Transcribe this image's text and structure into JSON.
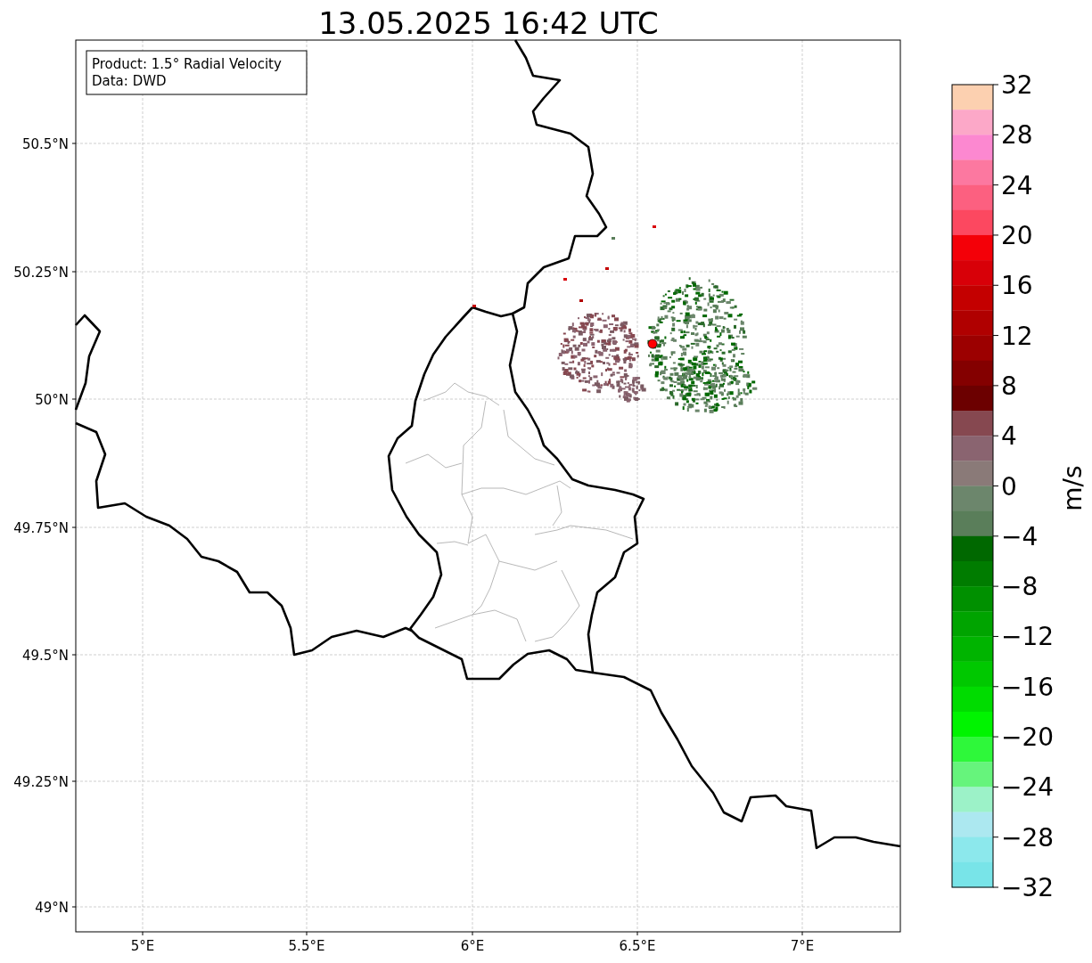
{
  "title": "13.05.2025 16:42 UTC",
  "info_box": [
    "Product: 1.5° Radial Velocity",
    "Data: DWD"
  ],
  "lat_ticks": [
    "50.5°N",
    "50.25°N",
    "50°N",
    "49.75°N",
    "49.5°N",
    "49.25°N",
    "49°N"
  ],
  "lon_ticks": [
    "5°E",
    "5.5°E",
    "6°E",
    "6.5°E",
    "7°E"
  ],
  "colorbar": {
    "label": "m/s",
    "ticks": [
      "32",
      "28",
      "24",
      "20",
      "16",
      "12",
      "8",
      "4",
      "0",
      "−4",
      "−8",
      "−12",
      "−16",
      "−20",
      "−24",
      "−28",
      "−32"
    ],
    "bands": [
      {
        "color": "#fcd0b0"
      },
      {
        "color": "#fca8c8"
      },
      {
        "color": "#fc88d0"
      },
      {
        "color": "#fc78a0"
      },
      {
        "color": "#fc6080"
      },
      {
        "color": "#fc4860"
      },
      {
        "color": "#f40008"
      },
      {
        "color": "#d80008"
      },
      {
        "color": "#c40000"
      },
      {
        "color": "#b00000"
      },
      {
        "color": "#9c0000"
      },
      {
        "color": "#840000"
      },
      {
        "color": "#6c0000"
      },
      {
        "color": "#864850"
      },
      {
        "color": "#8a6470"
      },
      {
        "color": "#8a7a78"
      },
      {
        "color": "#6c866c"
      },
      {
        "color": "#5a7e5a"
      },
      {
        "color": "#006800"
      },
      {
        "color": "#007c00"
      },
      {
        "color": "#009000"
      },
      {
        "color": "#00a400"
      },
      {
        "color": "#00b400"
      },
      {
        "color": "#00c800"
      },
      {
        "color": "#00dc00"
      },
      {
        "color": "#00f400"
      },
      {
        "color": "#2ef83a"
      },
      {
        "color": "#66f47c"
      },
      {
        "color": "#9cf2c8"
      },
      {
        "color": "#ace8f0"
      },
      {
        "color": "#8ce8ec"
      },
      {
        "color": "#78e4e8"
      }
    ]
  }
}
